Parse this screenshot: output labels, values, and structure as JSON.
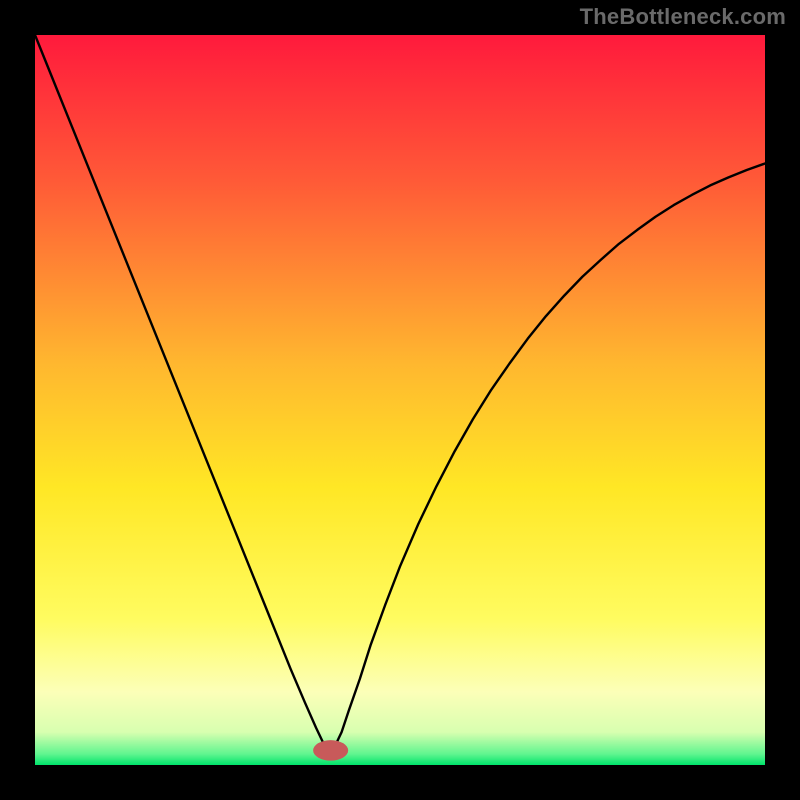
{
  "watermark": "TheBottleneck.com",
  "chart_data": {
    "type": "line",
    "title": "",
    "xlabel": "",
    "ylabel": "",
    "xlim": [
      0,
      100
    ],
    "ylim": [
      0,
      100
    ],
    "grid": false,
    "legend": false,
    "background_gradient": {
      "stops": [
        {
          "offset": 0.0,
          "color": "#ff1a3c"
        },
        {
          "offset": 0.2,
          "color": "#ff5a37"
        },
        {
          "offset": 0.45,
          "color": "#ffb72f"
        },
        {
          "offset": 0.62,
          "color": "#ffe725"
        },
        {
          "offset": 0.8,
          "color": "#fffc60"
        },
        {
          "offset": 0.9,
          "color": "#fcffb8"
        },
        {
          "offset": 0.955,
          "color": "#d8ffb0"
        },
        {
          "offset": 0.985,
          "color": "#60f58f"
        },
        {
          "offset": 1.0,
          "color": "#00e36b"
        }
      ]
    },
    "marker": {
      "x": 40.5,
      "y": 2.0,
      "rx": 2.4,
      "ry": 1.4,
      "color": "#c85a5a"
    },
    "series": [
      {
        "name": "curve",
        "color": "#000000",
        "stroke_width": 2.4,
        "x": [
          0.0,
          2.5,
          5.0,
          7.5,
          10.0,
          12.5,
          15.0,
          17.5,
          20.0,
          22.5,
          25.0,
          27.5,
          30.0,
          32.5,
          35.0,
          37.0,
          38.5,
          39.5,
          40.2,
          40.5,
          41.0,
          42.0,
          43.0,
          44.5,
          46.0,
          48.0,
          50.0,
          52.5,
          55.0,
          57.5,
          60.0,
          62.5,
          65.0,
          67.5,
          70.0,
          72.5,
          75.0,
          77.5,
          80.0,
          82.5,
          85.0,
          87.5,
          90.0,
          92.5,
          95.0,
          97.5,
          100.0
        ],
        "y": [
          100.0,
          93.8,
          87.6,
          81.4,
          75.2,
          69.0,
          62.8,
          56.6,
          50.4,
          44.2,
          38.0,
          31.8,
          25.6,
          19.4,
          13.2,
          8.5,
          5.1,
          3.0,
          2.2,
          2.0,
          2.4,
          4.5,
          7.5,
          11.8,
          16.5,
          22.0,
          27.2,
          33.0,
          38.2,
          43.0,
          47.4,
          51.4,
          55.0,
          58.4,
          61.5,
          64.3,
          66.9,
          69.2,
          71.4,
          73.3,
          75.1,
          76.7,
          78.1,
          79.4,
          80.5,
          81.5,
          82.4
        ]
      }
    ]
  }
}
